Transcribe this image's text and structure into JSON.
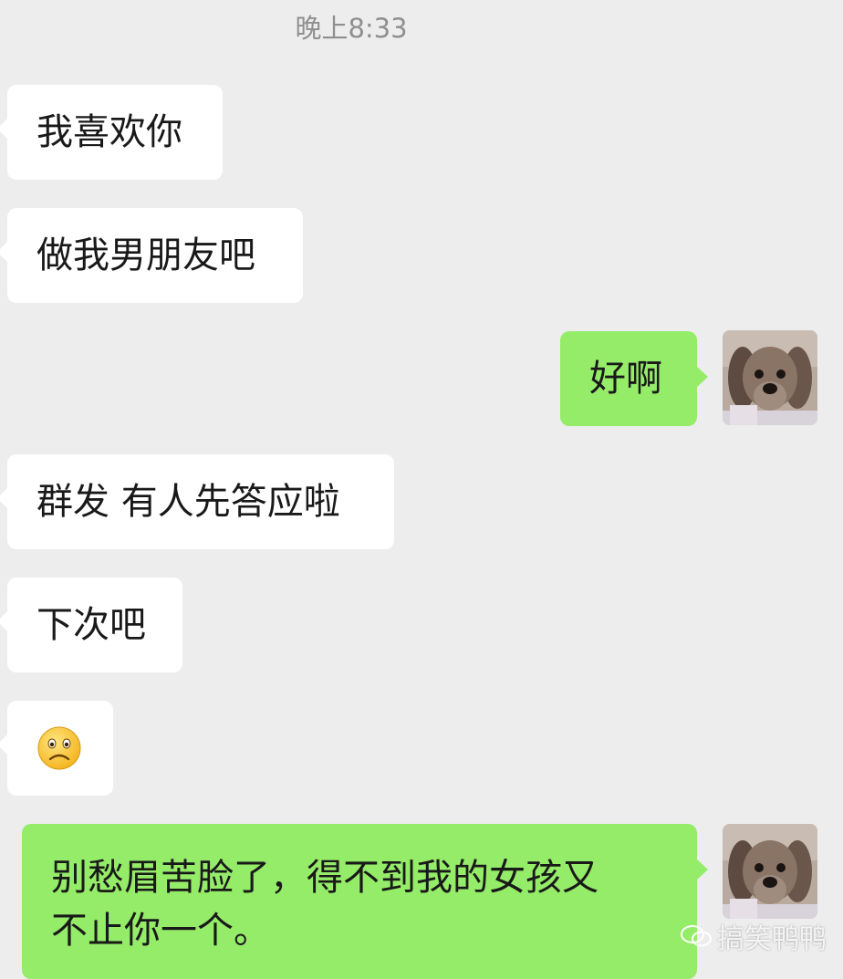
{
  "timestamp": "晚上8:33",
  "messages": {
    "m1": "我喜欢你",
    "m2": "做我男朋友吧",
    "m3": "好啊",
    "m4": "群发 有人先答应啦",
    "m5": "下次吧",
    "m6_emoji": "frowning-face",
    "m7_line1": "别愁眉苦脸了，得不到我的女孩又",
    "m7_line2": "不止你一个。"
  },
  "watermark": "搞笑鸭鸭",
  "colors": {
    "background": "#ededed",
    "incoming_bubble": "#ffffff",
    "outgoing_bubble": "#95ec69",
    "timestamp_text": "#8f8f8f"
  }
}
